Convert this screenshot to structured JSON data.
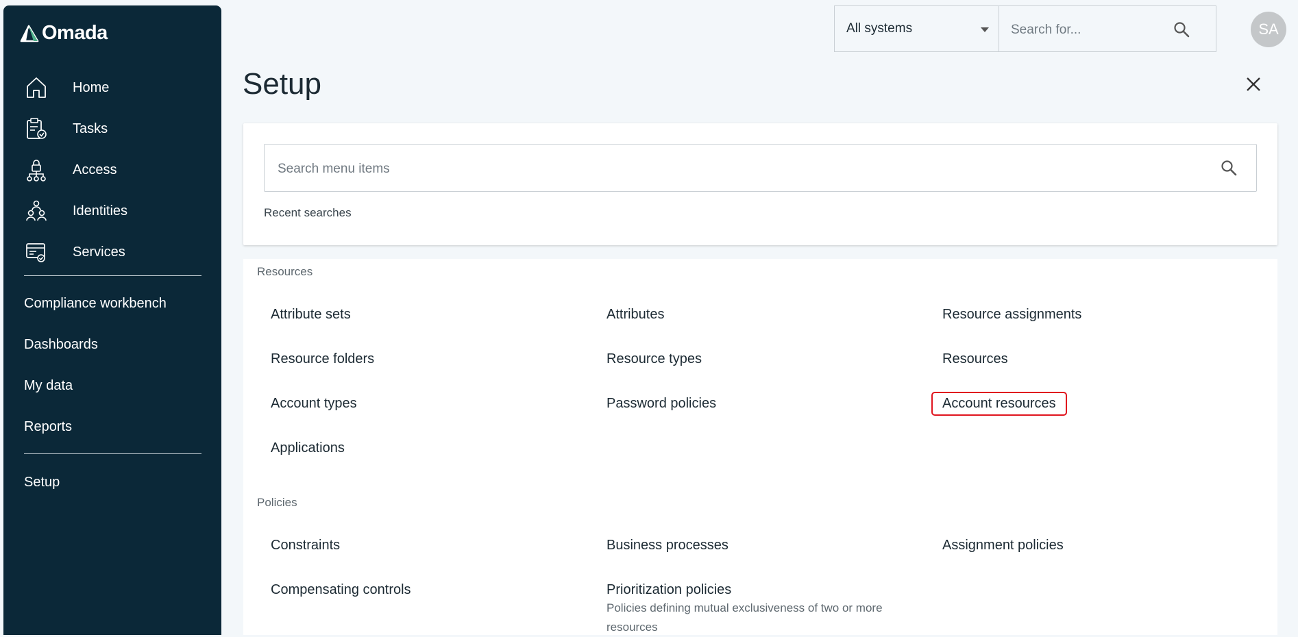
{
  "app": {
    "logo_text": "Omada"
  },
  "sidebar": {
    "icon_items": [
      {
        "label": "Home",
        "icon": "home-icon"
      },
      {
        "label": "Tasks",
        "icon": "tasks-clipboard-icon"
      },
      {
        "label": "Access",
        "icon": "access-lock-icon"
      },
      {
        "label": "Identities",
        "icon": "identities-people-icon"
      },
      {
        "label": "Services",
        "icon": "services-icon"
      }
    ],
    "text_items": [
      "Compliance workbench",
      "Dashboards",
      "My data",
      "Reports"
    ],
    "setup_label": "Setup"
  },
  "topbar": {
    "system_select": "All systems",
    "search_placeholder": "Search for...",
    "avatar_initials": "SA"
  },
  "page": {
    "title": "Setup",
    "menu_search_placeholder": "Search menu items",
    "recent_searches": "Recent searches"
  },
  "sections": [
    {
      "title": "Resources",
      "items": [
        "Attribute sets",
        "Attributes",
        "Resource assignments",
        "Resource folders",
        "Resource types",
        "Resources",
        "Account types",
        "Password policies",
        "Account resources",
        "Applications"
      ]
    },
    {
      "title": "Policies",
      "items": [
        "Constraints",
        "Business processes",
        "Assignment policies",
        "Compensating controls",
        "Prioritization policies"
      ],
      "descriptions": {
        "Prioritization policies": "Policies defining mutual exclusiveness of two or more resources"
      }
    }
  ],
  "colors": {
    "sidebar_bg": "#0b2838",
    "page_bg": "#f3f7fa",
    "highlight_border": "#e0141e",
    "logo_accent": "#4fb08a"
  }
}
